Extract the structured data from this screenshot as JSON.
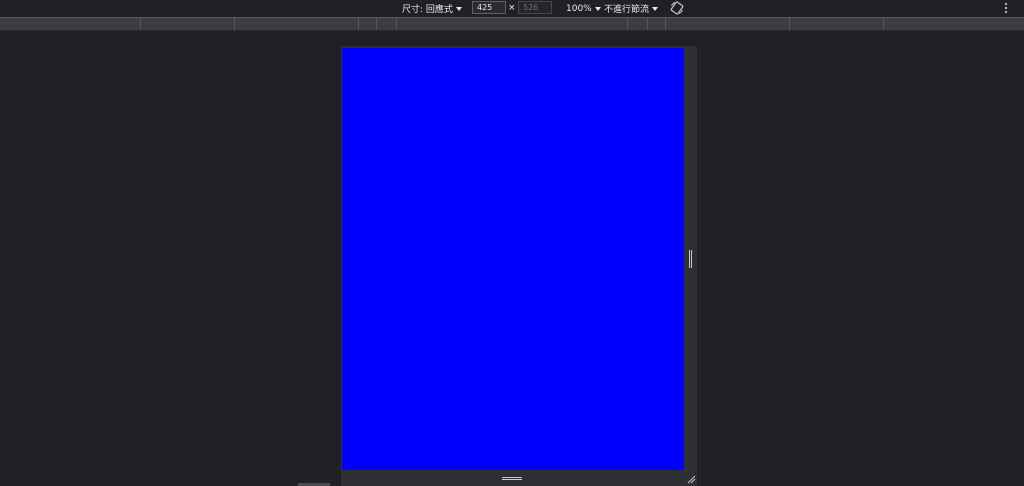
{
  "toolbar": {
    "dimensions_label": "尺寸: 回應式",
    "width_value": "425",
    "height_placeholder": "526",
    "times_symbol": "×",
    "zoom_label": "100%",
    "throttling_label": "不進行節流",
    "rotate_icon": "rotate-icon",
    "more_icon": "kebab-menu-icon"
  },
  "viewport": {
    "background_color": "#0000ff",
    "frame_color": "#2f3033"
  },
  "theme": {
    "background": "#202124",
    "text": "#e8eaed",
    "media_query_bar": "#3c3d40"
  }
}
